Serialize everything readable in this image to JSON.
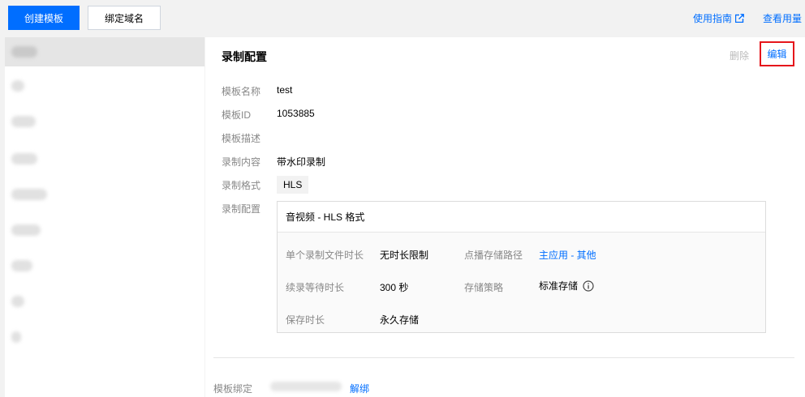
{
  "toolbar": {
    "create_label": "创建模板",
    "bind_domain_label": "绑定域名",
    "guide_label": "使用指南",
    "usage_label": "查看用量"
  },
  "detail": {
    "title": "录制配置",
    "delete_label": "删除",
    "edit_label": "编辑",
    "fields": {
      "name_label": "模板名称",
      "name_value": "test",
      "id_label": "模板ID",
      "id_value": "1053885",
      "desc_label": "模板描述",
      "content_label": "录制内容",
      "content_value": "带水印录制",
      "format_label": "录制格式",
      "format_value": "HLS",
      "config_label": "录制配置"
    },
    "config_box": {
      "header": "音视频 - HLS 格式",
      "file_duration_label": "单个录制文件时长",
      "file_duration_value": "无时长限制",
      "vod_path_label": "点播存储路径",
      "vod_path_value": "主应用 - 其他",
      "wait_label": "续录等待时长",
      "wait_value": "300 秒",
      "storage_policy_label": "存储策略",
      "storage_policy_value": "标准存储",
      "retention_label": "保存时长",
      "retention_value": "永久存储"
    },
    "binding": {
      "label": "模板绑定",
      "unbind_label": "解绑"
    }
  },
  "colors": {
    "primary": "#006eff",
    "highlight_border": "#e5161b"
  }
}
